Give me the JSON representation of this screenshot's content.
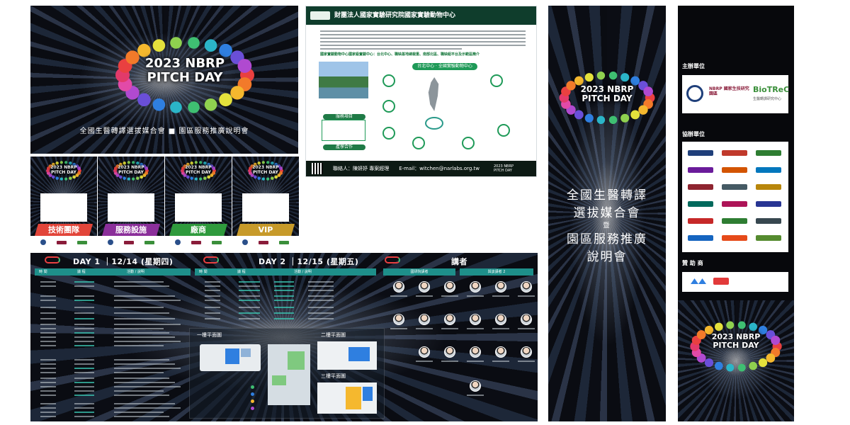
{
  "event": {
    "year_title": "2023 NBRP",
    "pitch_day": "PITCH DAY",
    "subtitle_line": "全國生醫轉譯選拔媒合會 ■ 園區服務推廣說明會",
    "banner_line1": "全國生醫轉譯",
    "banner_line2": "選拔媒合會",
    "banner_line3": "暨",
    "banner_line4": "園區服務推廣",
    "banner_line5": "說明會"
  },
  "badges": [
    {
      "role": "技術團隊",
      "color": "#e2453a"
    },
    {
      "role": "服務設施",
      "color": "#8b2f9a"
    },
    {
      "role": "廠商",
      "color": "#2f9a3d"
    },
    {
      "role": "VIP",
      "color": "#c79a2a"
    }
  ],
  "poster": {
    "header": "財團法人國家實驗研究院國家實驗動物中心",
    "highlight": "國家實驗動物中心國家級實驗中心：台北中心、職缺基地總裁重、南部北區、職缺組平台及示範區簡介",
    "center_label": "台北中心 · 全國實驗動物中心",
    "contact": "聯絡人：陳妍妤 專案經理",
    "email": "E-mail：witchen@narlabs.org.tw",
    "foot_logo": "2023 NBRP PITCH DAY",
    "section_a": "服務項目",
    "section_b": "產學合作"
  },
  "schedule": {
    "day1": "DAY 1 ｜12/14 (星期四)",
    "day2": "DAY 2 ｜12/15 (星期五)",
    "speakers": "講者",
    "col_time": "時 間",
    "col_topic": "議 程",
    "col_detail": "活動 / 說明",
    "speaker_group1": "國研院講者",
    "speaker_group2": "與談講者 2",
    "map_floor1": "一樓平面圖",
    "map_floor2": "二樓平面圖",
    "map_floor3": "三樓平面圖"
  },
  "sponsor_banner": {
    "organizer": "主辦單位",
    "co_organizer": "協辦單位",
    "sponsor": "贊 助 商",
    "org_logo_1": "NBRP 國家生技研究園區",
    "org_logo_2": "BioTReC",
    "org_logo_2_sub": "生醫轉譯研究中心"
  },
  "colors": {
    "ring": [
      "#e94040",
      "#f27a2a",
      "#f5b82e",
      "#e4e13c",
      "#8fd14f",
      "#3fbf72",
      "#2bb5c8",
      "#2f7fe0",
      "#6a4fd8",
      "#b04ad0",
      "#e24aa8",
      "#e23a6a"
    ],
    "teal_bar": "#1e8f8a",
    "poster_green": "#0f3d2c"
  }
}
